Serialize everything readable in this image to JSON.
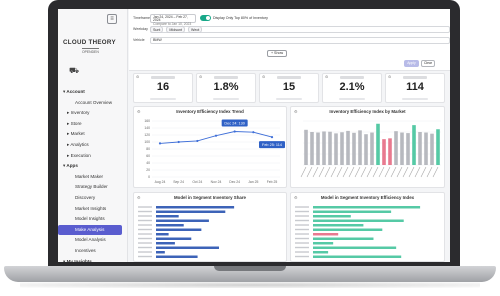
{
  "header": {
    "timeframe_label": "Timeframe",
    "date_range": "Jan 24, 2024 – Feb 27, 2024",
    "date_compare": "Compare to Jan 10, 2023",
    "toggle_label": "Display Only Top 80% of Inventory",
    "weekday_label": "Weekday",
    "weekday_chips": [
      "Sunt",
      "Midsunt",
      "Weot"
    ],
    "vehicle_label": "Vehicle",
    "vehicle_value": "BMW",
    "show_label": "+ Show",
    "apply_label": "Apply",
    "clear_label": "Clear"
  },
  "brand": {
    "name": "CLOUD THEORY",
    "sub": "OPENDEN"
  },
  "sidebar": {
    "items": [
      {
        "label": "▾ Account",
        "level": "top"
      },
      {
        "label": "Account Overview",
        "level": "l2"
      },
      {
        "label": "▸ Inventory",
        "level": "l1"
      },
      {
        "label": "▸ Store",
        "level": "l1"
      },
      {
        "label": "▸ Market",
        "level": "l1"
      },
      {
        "label": "▸ Analytics",
        "level": "l1"
      },
      {
        "label": "▸ Execution",
        "level": "l1"
      },
      {
        "label": "▾ Apps",
        "level": "top"
      },
      {
        "label": "Market Maker",
        "level": "l2"
      },
      {
        "label": "Strategy Builder",
        "level": "l2"
      },
      {
        "label": "Discovery",
        "level": "l2"
      },
      {
        "label": "Market Insights",
        "level": "l2"
      },
      {
        "label": "Model Insights",
        "level": "l2"
      },
      {
        "label": "Make Analysis",
        "level": "l2",
        "active": true
      },
      {
        "label": "Model Analysis",
        "level": "l2"
      },
      {
        "label": "Incentives",
        "level": "l2"
      },
      {
        "label": "▾ My Insights",
        "level": "top"
      }
    ]
  },
  "kpis": [
    {
      "value": "16"
    },
    {
      "value": "1.8%"
    },
    {
      "value": "15"
    },
    {
      "value": "2.1%"
    },
    {
      "value": "114"
    }
  ],
  "panels": {
    "trend_title": "Inventory Efficiency Index Trend",
    "market_title": "Inventory Efficiency Index by Market",
    "share_title": "Model in Segment Inventory Share",
    "segment_title": "Model in Segment Inventory Efficiency Index"
  },
  "colors": {
    "accent": "#5a5dcf",
    "line": "#3f6fd8",
    "teal": "#55c9a5",
    "pink": "#e8798f",
    "gray": "#b7b9bf",
    "blue_bar": "#3c63b8"
  },
  "chart_data": [
    {
      "type": "line",
      "title": "Inventory Efficiency Index Trend",
      "x": [
        "Aug 24",
        "Sep 24",
        "Oct 24",
        "Nov 24",
        "Dec 24",
        "Jan 25",
        "Feb 25"
      ],
      "y_ticks": [
        0,
        20,
        40,
        60,
        80,
        100,
        120,
        140,
        160
      ],
      "ylim": [
        0,
        160
      ],
      "series": [
        {
          "values": [
            96,
            100,
            103,
            118,
            130,
            128,
            114
          ]
        }
      ],
      "annotations": [
        {
          "text": "Dec 24: 130",
          "x": "Dec 24"
        },
        {
          "text": "Feb 25: 114",
          "x": "Feb 25"
        }
      ]
    },
    {
      "type": "bar",
      "title": "Inventory Efficiency Index by Market",
      "values": [
        128,
        120,
        118,
        122,
        121,
        115,
        119,
        124,
        117,
        126,
        112,
        118,
        150,
        94,
        97,
        123,
        118,
        116,
        145,
        120,
        118,
        114,
        130
      ],
      "highlight": {
        "12": "teal",
        "13": "pink",
        "14": "pink",
        "18": "teal",
        "22": "teal"
      },
      "ylim": [
        0,
        160
      ]
    },
    {
      "type": "bar",
      "orientation": "horizontal",
      "title": "Model in Segment Inventory Share",
      "values": [
        0.62,
        0.55,
        0.18,
        0.42,
        0.22,
        0.36,
        0.1,
        0.28,
        0.15,
        0.5,
        0.07,
        0.33
      ]
    },
    {
      "type": "bar",
      "orientation": "horizontal",
      "title": "Model in Segment Inventory Efficiency Index",
      "values": [
        0.85,
        0.62,
        0.3,
        0.72,
        0.4,
        0.55,
        0.2,
        0.48,
        0.16,
        0.66,
        0.12,
        0.7
      ],
      "highlight": {
        "6": "pink"
      }
    }
  ]
}
